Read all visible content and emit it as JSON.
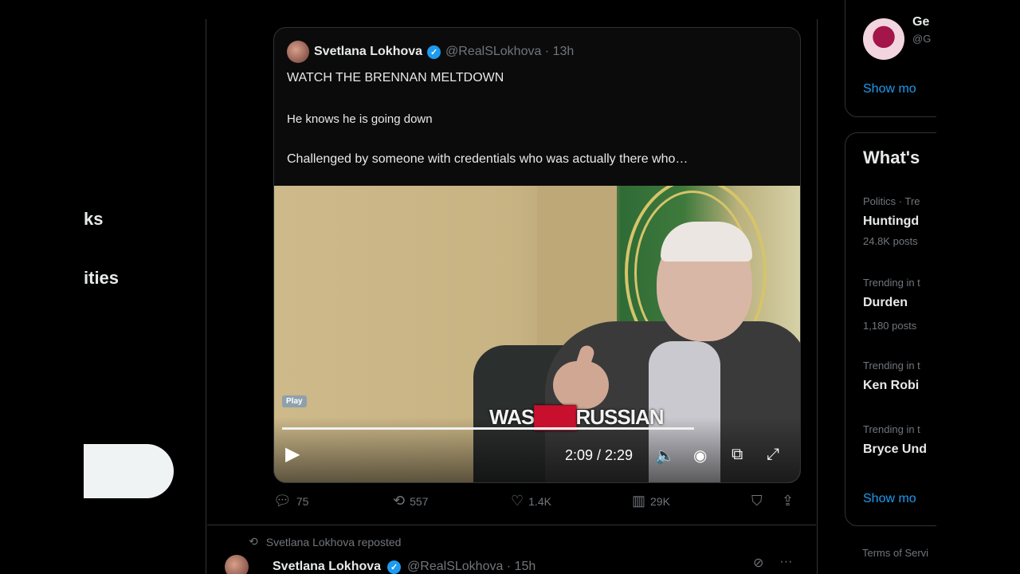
{
  "nav": {
    "item_1": "ks",
    "item_2": "ities"
  },
  "quote_tweet": {
    "author": "Svetlana Lokhova",
    "handle_time": "@RealSLokhova · 13h",
    "headline": "WATCH THE BRENNAN MELTDOWN",
    "line_2": "He knows he is going down",
    "line_3": "Challenged by someone with credentials who was actually there who…",
    "video": {
      "badge": "Play",
      "caption_left": "WAS",
      "caption_mid": "███",
      "caption_right": "RUSSIAN",
      "time": "2:09 / 2:29",
      "progress_fraction": 0.93
    }
  },
  "actions": {
    "replies": "75",
    "reposts": "557",
    "likes": "1.4K",
    "views": "29K"
  },
  "next_tweet": {
    "repost_label": "Svetlana Lokhova reposted",
    "author": "Svetlana Lokhova",
    "handle_time": "@RealSLokhova · 15h"
  },
  "right_sidebar": {
    "follow_name": "Ge",
    "follow_handle": "@G",
    "show_more_1": "Show mo",
    "trends_title": "What's",
    "trends": [
      {
        "context": "Politics · Tre",
        "name": "Huntingd",
        "posts": "24.8K posts"
      },
      {
        "context": "Trending in t",
        "name": "Durden",
        "posts": "1,180 posts"
      },
      {
        "context": "Trending in t",
        "name": "Ken Robi",
        "posts": ""
      },
      {
        "context": "Trending in t",
        "name": "Bryce Und",
        "posts": ""
      }
    ],
    "show_more_2": "Show mo",
    "footer": "Terms of Servi"
  },
  "colors": {
    "background": "#000000",
    "accent": "#1d9bf0",
    "muted": "#71767b",
    "text": "#e7e9ea"
  }
}
